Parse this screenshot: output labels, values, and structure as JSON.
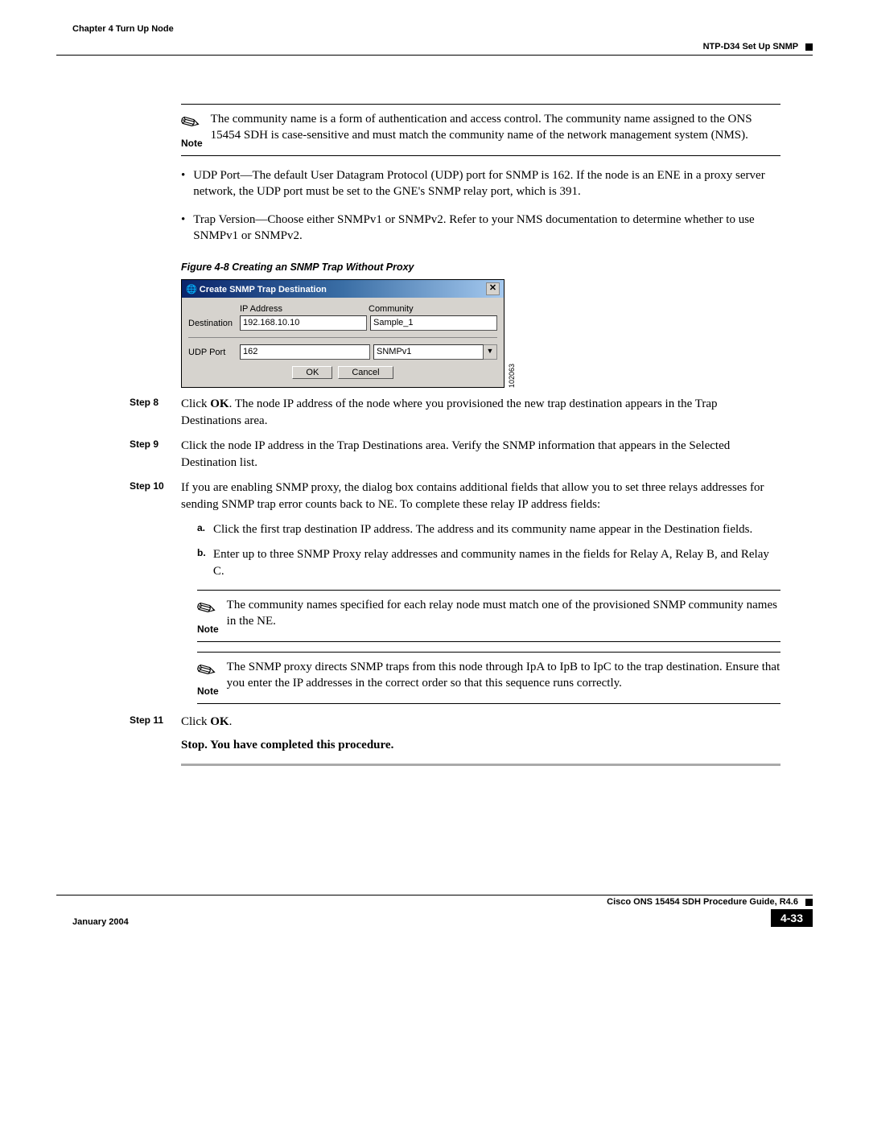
{
  "header": {
    "chapter": "Chapter 4      Turn Up Node",
    "section": "NTP-D34 Set Up SNMP"
  },
  "note1": {
    "label": "Note",
    "text": "The community name is a form of authentication and access control. The community name assigned to the ONS 15454 SDH is case-sensitive and must match the community name of the network management system (NMS)."
  },
  "bullets": [
    "UDP Port—The default User Datagram Protocol (UDP) port for SNMP is 162. If the node is an ENE in a proxy server network, the UDP port must be set to the GNE's SNMP relay port, which is 391.",
    "Trap Version—Choose either SNMPv1 or SNMPv2. Refer to your NMS documentation to determine whether to use SNMPv1 or SNMPv2."
  ],
  "figure": {
    "caption": "Figure 4-8    Creating an SNMP Trap Without Proxy",
    "side_num": "102063"
  },
  "dialog": {
    "title": "Create SNMP Trap Destination",
    "labels": {
      "ip": "IP Address",
      "community": "Community",
      "destination": "Destination",
      "udp": "UDP Port"
    },
    "values": {
      "ip": "192.168.10.10",
      "community": "Sample_1",
      "udp": "162",
      "version": "SNMPv1"
    },
    "buttons": {
      "ok": "OK",
      "cancel": "Cancel"
    }
  },
  "steps": {
    "s8": {
      "label": "Step 8",
      "text_before": "Click ",
      "bold": "OK",
      "text_after": ". The node IP address of the node where you provisioned the new trap destination appears in the Trap Destinations area."
    },
    "s9": {
      "label": "Step 9",
      "text": "Click the node IP address in the Trap Destinations area. Verify the SNMP information that appears in the Selected Destination list."
    },
    "s10": {
      "label": "Step 10",
      "text": "If you are enabling SNMP proxy, the dialog box contains additional fields that allow you to set three relays addresses for sending SNMP trap error counts back to NE. To complete these relay IP address fields:"
    },
    "s10a": {
      "label": "a.",
      "text": "Click the first trap destination IP address. The address and its community name appear in the Destination fields."
    },
    "s10b": {
      "label": "b.",
      "text": "Enter up to three SNMP Proxy relay addresses and community names in the fields for Relay A, Relay B, and Relay C."
    },
    "s11": {
      "label": "Step 11",
      "text_before": "Click ",
      "bold": "OK",
      "text_after": "."
    }
  },
  "note2": {
    "label": "Note",
    "text": "The community names specified for each relay node must match one of the provisioned SNMP community names in the NE."
  },
  "note3": {
    "label": "Note",
    "text": "The SNMP proxy directs SNMP traps from this node through IpA to IpB to IpC to the trap destination. Ensure that you enter the IP addresses in the correct order so that this sequence runs correctly."
  },
  "stop": "Stop. You have completed this procedure.",
  "footer": {
    "date": "January 2004",
    "book": "Cisco ONS 15454 SDH Procedure Guide, R4.6",
    "page": "4-33"
  }
}
